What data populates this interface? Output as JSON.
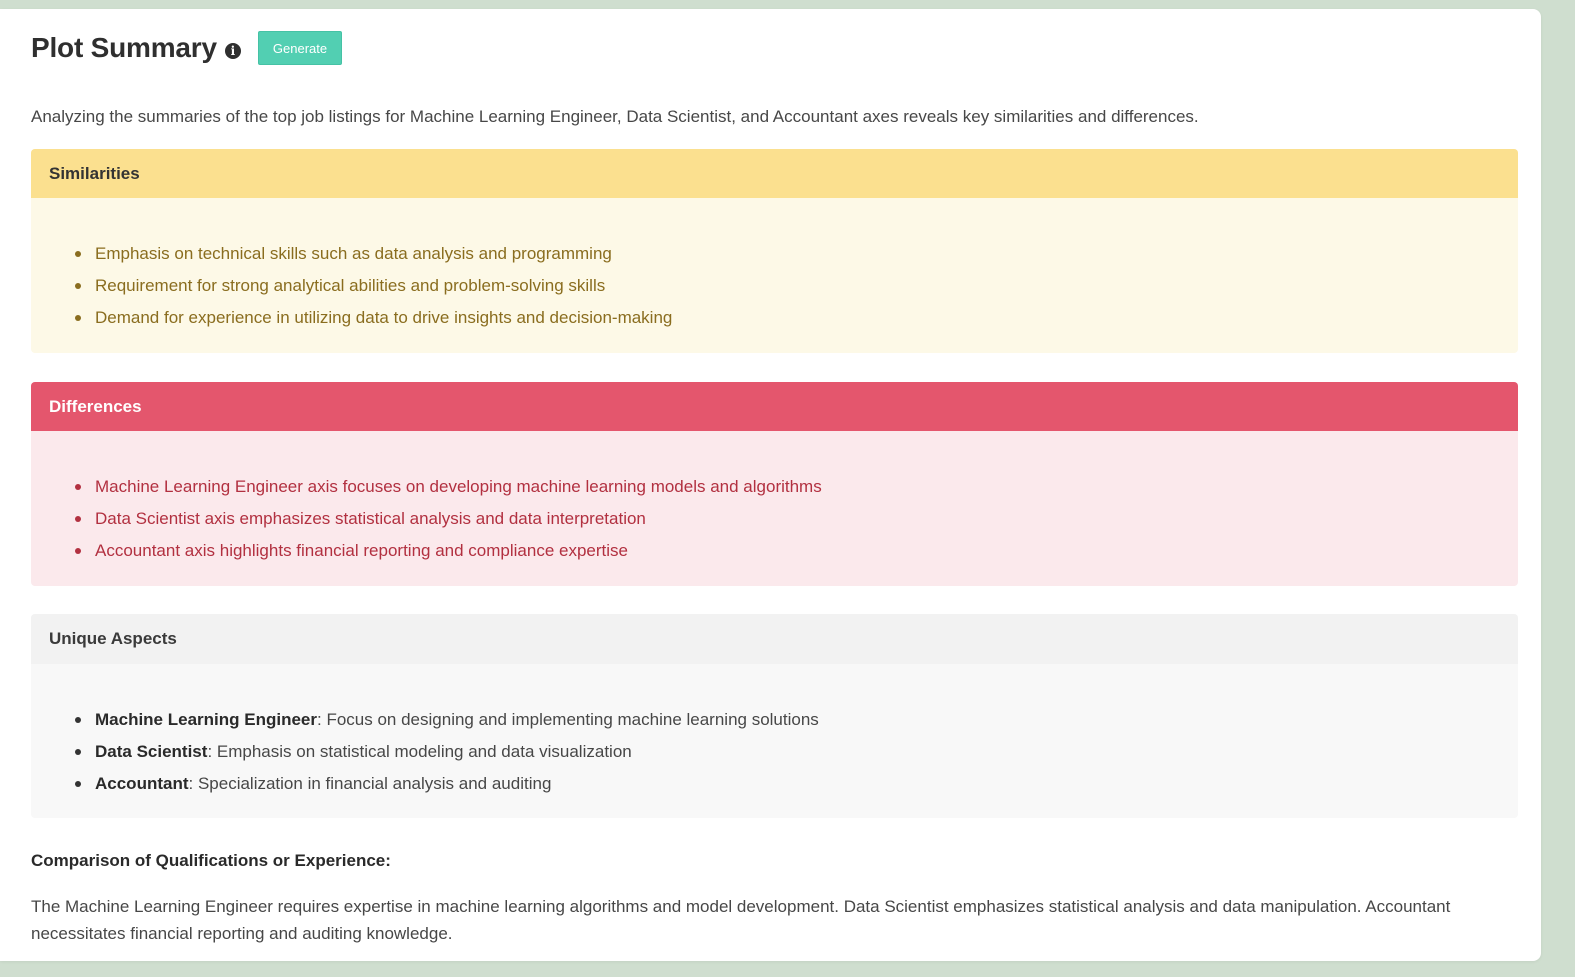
{
  "header": {
    "title": "Plot Summary",
    "info_icon": "info-circle",
    "generate_label": "Generate"
  },
  "intro": "Analyzing the summaries of the top job listings for Machine Learning Engineer, Data Scientist, and Accountant axes reveals key similarities and differences.",
  "similarities": {
    "title": "Similarities",
    "items": [
      "Emphasis on technical skills such as data analysis and programming",
      "Requirement for strong analytical abilities and problem-solving skills",
      "Demand for experience in utilizing data to drive insights and decision-making"
    ]
  },
  "differences": {
    "title": "Differences",
    "items": [
      "Machine Learning Engineer axis focuses on developing machine learning models and algorithms",
      "Data Scientist axis emphasizes statistical analysis and data interpretation",
      "Accountant axis highlights financial reporting and compliance expertise"
    ]
  },
  "unique": {
    "title": "Unique Aspects",
    "items": [
      {
        "role": "Machine Learning Engineer",
        "text": ": Focus on designing and implementing machine learning solutions"
      },
      {
        "role": "Data Scientist",
        "text": ": Emphasis on statistical modeling and data visualization"
      },
      {
        "role": "Accountant",
        "text": ": Specialization in financial analysis and auditing"
      }
    ]
  },
  "comparison": {
    "title": "Comparison of Qualifications or Experience:",
    "text": "The Machine Learning Engineer requires expertise in machine learning algorithms and model development. Data Scientist emphasizes statistical analysis and data manipulation. Accountant necessitates financial reporting and auditing knowledge."
  },
  "colors": {
    "page_background": "#cfdecf",
    "generate_button": "#52cfb2",
    "similarities_header": "#fbe08f",
    "similarities_body": "#fdf9e7",
    "differences_header": "#e4566d",
    "differences_body": "#fbe9ec",
    "unique_header": "#f2f2f2",
    "unique_body": "#f8f8f8"
  }
}
